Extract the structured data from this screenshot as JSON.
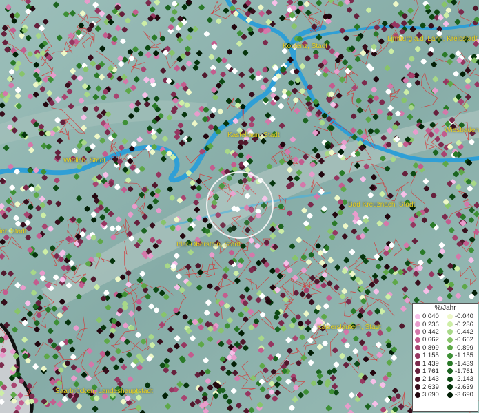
{
  "map": {
    "cities": [
      {
        "name": "Koblenz, Stadt"
      },
      {
        "name": "Limburg a.d. Lahn, Kreisstadt"
      },
      {
        "name": "Wiesbaden"
      },
      {
        "name": "Kastellaun, Stadt"
      },
      {
        "name": "Wittlich, Stadt"
      },
      {
        "name": "Bad Kreuznach, Stadt"
      },
      {
        "name": "Trier, Stadt"
      },
      {
        "name": "Idar-Oberstein, Stadt"
      },
      {
        "name": "Kaiserslautern, Stadt"
      },
      {
        "name": "Saarbrücken, Landeshauptstadt"
      }
    ],
    "colors": {
      "terrain": "#8fb5b0",
      "river": "#2f9fd6",
      "boundaries": "#d83030",
      "label": "#e8d020",
      "outside_area": "#c9cdd0"
    }
  },
  "legend": {
    "title": "%/Jahr",
    "positive": [
      {
        "label": "0.040",
        "color": "#f6bfe8"
      },
      {
        "label": "0.236",
        "color": "#e89ccc"
      },
      {
        "label": "0.442",
        "color": "#d478aa"
      },
      {
        "label": "0.662",
        "color": "#c45c8e"
      },
      {
        "label": "0.899",
        "color": "#a84470"
      },
      {
        "label": "1.155",
        "color": "#963660"
      },
      {
        "label": "1.439",
        "color": "#7c2a4c"
      },
      {
        "label": "1.761",
        "color": "#66203c"
      },
      {
        "label": "2.143",
        "color": "#50182c"
      },
      {
        "label": "2.639",
        "color": "#380e1c"
      },
      {
        "label": "3.690",
        "color": "#22060e"
      }
    ],
    "negative": [
      {
        "label": "-0.040",
        "color": "#eef8c8"
      },
      {
        "label": "-0.236",
        "color": "#cdeea6"
      },
      {
        "label": "-0.442",
        "color": "#a8d888"
      },
      {
        "label": "-0.662",
        "color": "#88c46a"
      },
      {
        "label": "-0.899",
        "color": "#5ea848"
      },
      {
        "label": "-1.155",
        "color": "#3e9036"
      },
      {
        "label": "-1.439",
        "color": "#2a7a28"
      },
      {
        "label": "-1.761",
        "color": "#1c6420"
      },
      {
        "label": "-2.143",
        "color": "#0e4a14"
      },
      {
        "label": "-2.639",
        "color": "#06340c"
      },
      {
        "label": "-3.690",
        "color": "#021e06"
      }
    ]
  }
}
